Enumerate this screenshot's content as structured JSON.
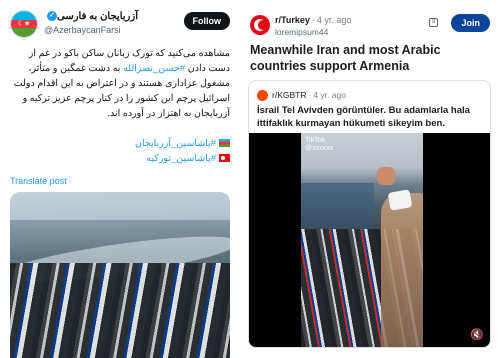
{
  "twitter": {
    "display_name": "آزربایجان به فارسی",
    "handle": "@AzerbaycanFarsi",
    "follow_label": "Follow",
    "text_part1": "مشاهده می‌کنید که تورک زبانان ساکن باکو در غم از دست دادن ",
    "text_hashtag": "#حسن_نصرالله",
    "text_part2": " به دشت غمگین و متأثر، مشغول عزاداری هستند و در اعتراض به این اقدام دولت اسرائیل پرچم این کشور را در کنار پرچم عزیز ترکیه و آزربایجان به اهتزاز در آورده اند.",
    "hashtags": [
      "#یاشاسین_آزربایجان",
      "#یاشاسین_تورکیه"
    ],
    "translate_label": "Translate post"
  },
  "reddit": {
    "subreddit": "r/Turkey",
    "age": "4 yr. ago",
    "username": "loremipsum44",
    "join_label": "Join",
    "title": "Meanwhile Iran and most Arabic countries support Armenia",
    "quoted": {
      "subreddit": "r/KGBTR",
      "age": "4 yr. ago",
      "text": "İsrail Tel Avivden görüntüler. Bu adamlarla hala ittifaklık kurmayan hükumeti sikeyim ben."
    },
    "video_watermark": "TikTok",
    "video_user": "@xxxxxx"
  },
  "colors": {
    "twitter_blue": "#1d9bf0",
    "reddit_join": "#0a449b",
    "follow_button": "#0f1419"
  },
  "icons": [
    "verified-badge-icon",
    "azerbaijan-flag-icon",
    "turkey-flag-icon",
    "subreddit-avatar-icon",
    "sort-icon",
    "mute-icon"
  ]
}
